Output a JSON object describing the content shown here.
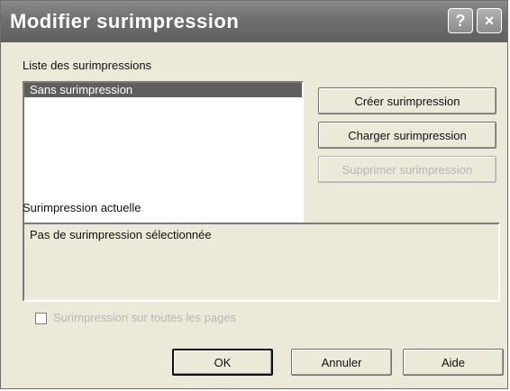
{
  "window": {
    "title": "Modifier surimpression"
  },
  "titlebar": {
    "help_icon": "?",
    "close_icon": "×"
  },
  "list_section": {
    "label": "Liste des surimpressions",
    "items": [
      "Sans surimpression"
    ]
  },
  "actions": {
    "create_label": "Créer surimpression",
    "load_label": "Charger surimpression",
    "delete_label": "Supprimer surimpression"
  },
  "current_section": {
    "label": "Surimpression actuelle",
    "value": "Pas de surimpression sélectionnée"
  },
  "options": {
    "checkbox_label": "Surimpression sur toutes les pages",
    "checked": false
  },
  "footer": {
    "ok_label": "OK",
    "cancel_label": "Annuler",
    "help_label": "Aide"
  }
}
